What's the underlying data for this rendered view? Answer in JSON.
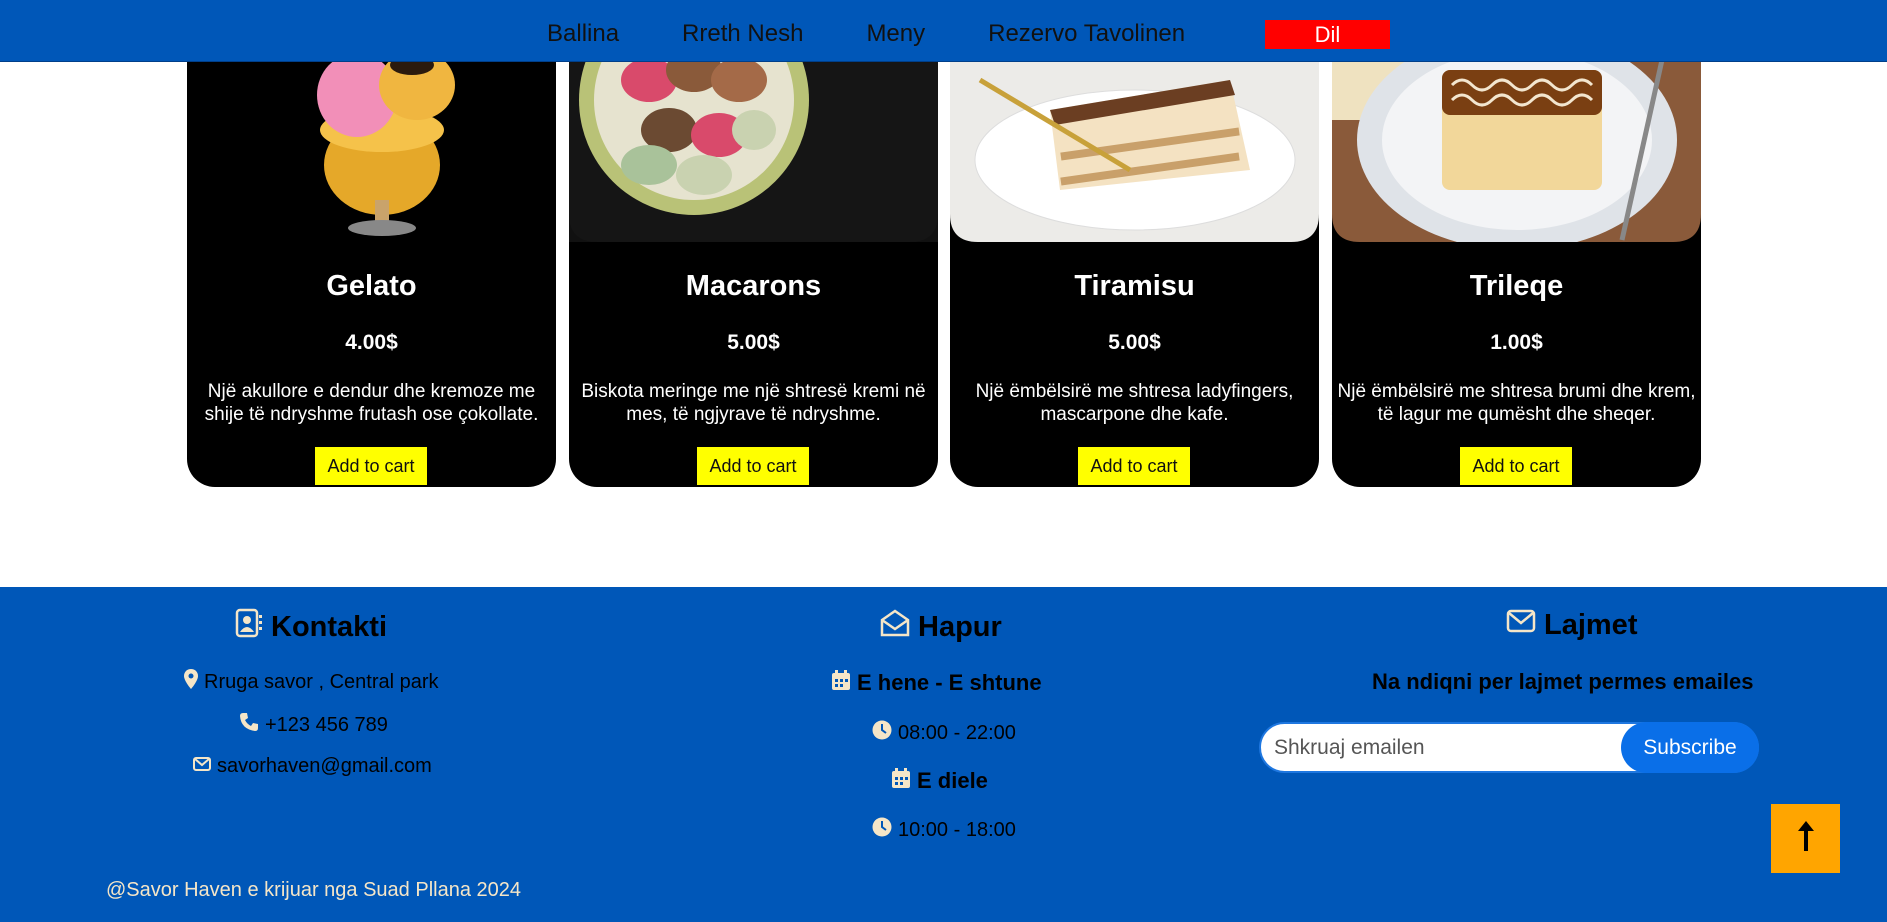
{
  "nav": {
    "items": [
      "Ballina",
      "Rreth Nesh",
      "Meny",
      "Rezervo Tavolinen"
    ],
    "logout": "Dil"
  },
  "products": [
    {
      "name": "Gelato",
      "price": "4.00$",
      "description": "Një akullore e dendur dhe kremoze me shije të ndryshme frutash ose çokollate.",
      "button": "Add to cart"
    },
    {
      "name": "Macarons",
      "price": "5.00$",
      "description": "Biskota meringe me një shtresë kremi në mes, të ngjyrave të ndryshme.",
      "button": "Add to cart"
    },
    {
      "name": "Tiramisu",
      "price": "5.00$",
      "description": "Një ëmbëlsirë me shtresa ladyfingers, mascarpone dhe kafe.",
      "button": "Add to cart"
    },
    {
      "name": "Trileqe",
      "price": "1.00$",
      "description": "Një ëmbëlsirë me shtresa brumi dhe krem, të lagur me qumësht dhe sheqer.",
      "button": "Add to cart"
    }
  ],
  "footer": {
    "contact": {
      "title": "Kontakti",
      "address": "Rruga savor , Central park",
      "phone": "+123 456 789",
      "email": "savorhaven@gmail.com"
    },
    "hours": {
      "title": "Hapur",
      "weekdays": "E hene - E shtune",
      "weekdays_time": "08:00 - 22:00",
      "sunday": "E diele",
      "sunday_time": "10:00 - 18:00"
    },
    "news": {
      "title": "Lajmet",
      "subtitle": "Na ndiqni per lajmet permes emailes",
      "placeholder": "Shkruaj emailen",
      "subscribe": "Subscribe"
    },
    "copyright": "@Savor Haven e krijuar nga Suad Pllana 2024"
  },
  "colors": {
    "primary": "#0057b8",
    "logout": "#ff0000",
    "cart_button": "#ffff00",
    "footer_text": "#f5e6c8",
    "subscribe": "#0a6fe8",
    "to_top": "#ffa500"
  },
  "icons": {
    "contact": "address-book-icon",
    "hours": "envelope-open-icon",
    "news": "envelope-icon",
    "address": "map-marker-icon",
    "phone": "phone-icon",
    "email": "envelope-icon",
    "calendar": "calendar-icon",
    "clock": "clock-icon",
    "to_top": "arrow-up-icon"
  }
}
